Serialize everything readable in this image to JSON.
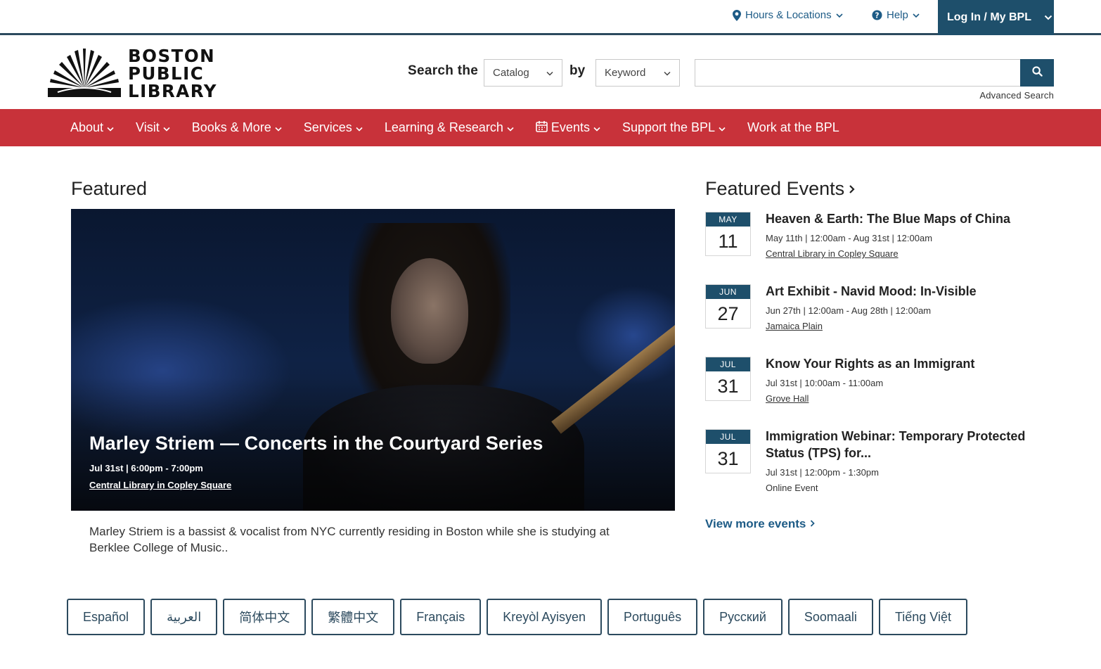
{
  "utility": {
    "hours_label": "Hours & Locations",
    "help_label": "Help",
    "login_label": "Log In / My BPL"
  },
  "brand": {
    "logo_lines": [
      "BOSTON",
      "PUBLIC",
      "LIBRARY"
    ]
  },
  "search": {
    "label": "Search the",
    "scope_value": "Catalog",
    "by_label": "by",
    "field_value": "Keyword",
    "query_value": "",
    "advanced_label": "Advanced Search"
  },
  "nav": {
    "items": [
      {
        "label": "About",
        "has_menu": true
      },
      {
        "label": "Visit",
        "has_menu": true
      },
      {
        "label": "Books & More",
        "has_menu": true
      },
      {
        "label": "Services",
        "has_menu": true
      },
      {
        "label": "Learning & Research",
        "has_menu": true
      },
      {
        "label": "Events",
        "has_menu": true,
        "icon": "calendar-icon"
      },
      {
        "label": "Support the BPL",
        "has_menu": true
      },
      {
        "label": "Work at the BPL",
        "has_menu": false
      }
    ]
  },
  "featured": {
    "heading": "Featured",
    "title": "Marley Striem — Concerts in the Courtyard Series",
    "date": "Jul 31st | 6:00pm - 7:00pm",
    "location": "Central Library in Copley Square",
    "description": "Marley Striem is a bassist & vocalist from NYC currently residing in Boston while she is studying at Berklee College of Music.."
  },
  "events": {
    "heading": "Featured Events",
    "items": [
      {
        "month": "MAY",
        "day": "11",
        "title": "Heaven & Earth: The Blue Maps of China",
        "time": "May 11th | 12:00am - Aug 31st | 12:00am",
        "location": "Central Library in Copley Square",
        "location_link": true
      },
      {
        "month": "JUN",
        "day": "27",
        "title": "Art Exhibit - Navid Mood: In-Visible",
        "time": "Jun 27th | 12:00am - Aug 28th | 12:00am",
        "location": "Jamaica Plain",
        "location_link": true
      },
      {
        "month": "JUL",
        "day": "31",
        "title": "Know Your Rights as an Immigrant",
        "time": "Jul 31st | 10:00am - 11:00am",
        "location": "Grove Hall",
        "location_link": true
      },
      {
        "month": "JUL",
        "day": "31",
        "title": "Immigration Webinar: Temporary Protected Status (TPS) for...",
        "time": "Jul 31st | 12:00pm - 1:30pm",
        "location": "Online Event",
        "location_link": false
      }
    ],
    "view_more_label": "View more events"
  },
  "languages": [
    "Español",
    "العربية",
    "简体中文",
    "繁體中文",
    "Français",
    "Kreyòl Ayisyen",
    "Português",
    "Русский",
    "Soomaali",
    "Tiếng Việt"
  ],
  "colors": {
    "accent": "#1e4f6b",
    "nav_red": "#c8323a",
    "link_blue": "#1d5b86"
  }
}
